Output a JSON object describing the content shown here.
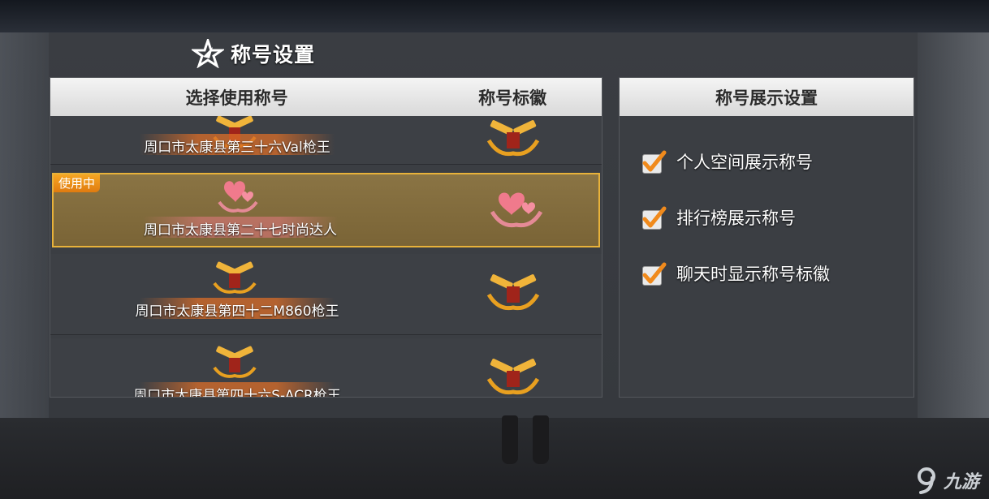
{
  "page": {
    "title": "称号设置"
  },
  "title_list": {
    "header_select": "选择使用称号",
    "header_badge": "称号标徽",
    "in_use_tag": "使用中",
    "rows": [
      {
        "name": "周口市太康县第三十六Val枪王",
        "emblem": "golden-pistols-icon",
        "active": false
      },
      {
        "name": "周口市太康县第二十七时尚达人",
        "emblem": "pink-hearts-icon",
        "active": true
      },
      {
        "name": "周口市太康县第四十二M860枪王",
        "emblem": "golden-pistols-icon",
        "active": false
      },
      {
        "name": "周口市太康县第四十六S-ACR枪王",
        "emblem": "golden-pistols-icon",
        "active": false
      }
    ]
  },
  "display_settings": {
    "header": "称号展示设置",
    "options": [
      {
        "label": "个人空间展示称号",
        "checked": true
      },
      {
        "label": "排行榜展示称号",
        "checked": true
      },
      {
        "label": "聊天时显示称号标徽",
        "checked": true
      }
    ]
  },
  "watermark": {
    "text": "九游"
  },
  "colors": {
    "accent_orange": "#f08a1c",
    "active_border": "#e8b23a",
    "header_bg": "#e6e6e6",
    "panel_bg": "#3b3e43"
  }
}
